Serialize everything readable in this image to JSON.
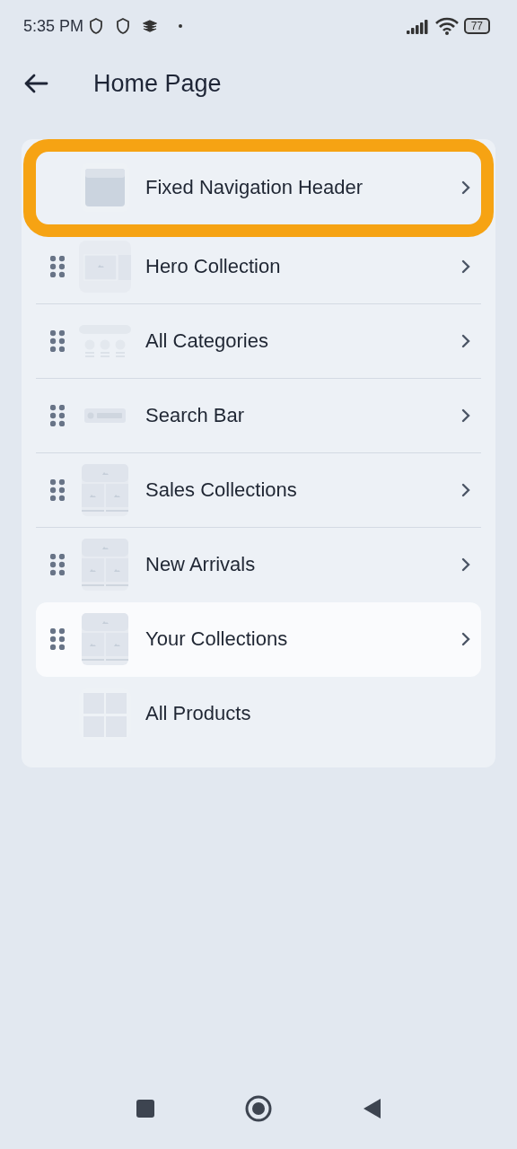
{
  "status_bar": {
    "time": "5:35 PM",
    "battery": "77"
  },
  "header": {
    "title": "Home Page"
  },
  "sections": [
    {
      "label": "Fixed Navigation Header",
      "kind": "header",
      "draggable": false,
      "chevron": true,
      "highlighted": true,
      "selected": false
    },
    {
      "label": "Hero Collection",
      "kind": "hero",
      "draggable": true,
      "chevron": true,
      "highlighted": false,
      "selected": false
    },
    {
      "label": "All Categories",
      "kind": "categories",
      "draggable": true,
      "chevron": true,
      "highlighted": false,
      "selected": false
    },
    {
      "label": "Search Bar",
      "kind": "search",
      "draggable": true,
      "chevron": true,
      "highlighted": false,
      "selected": false
    },
    {
      "label": "Sales Collections",
      "kind": "grid",
      "draggable": true,
      "chevron": true,
      "highlighted": false,
      "selected": false
    },
    {
      "label": "New Arrivals",
      "kind": "grid",
      "draggable": true,
      "chevron": true,
      "highlighted": false,
      "selected": false
    },
    {
      "label": "Your Collections",
      "kind": "grid",
      "draggable": true,
      "chevron": true,
      "highlighted": false,
      "selected": true
    },
    {
      "label": "All Products",
      "kind": "products",
      "draggable": false,
      "chevron": false,
      "highlighted": false,
      "selected": false
    }
  ]
}
